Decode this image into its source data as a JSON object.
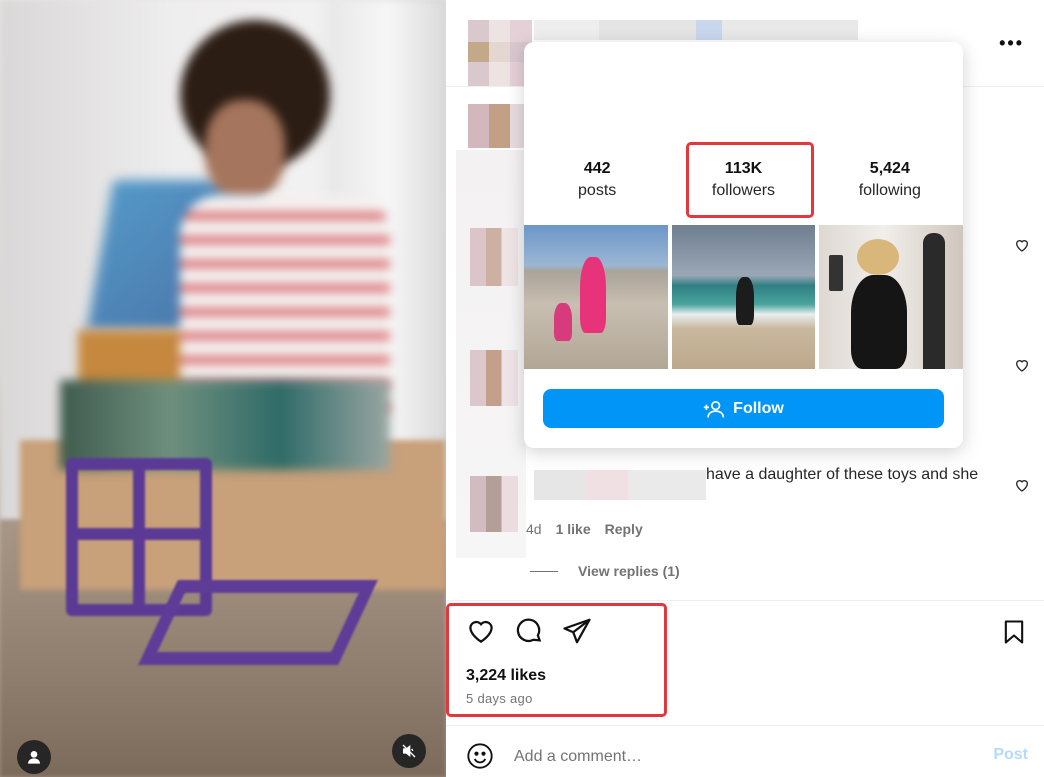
{
  "media": {
    "avatar_icon": "person-icon",
    "mute_icon": "speaker-muted-icon"
  },
  "post_header": {
    "more_label": "•••"
  },
  "hover_card": {
    "stats": [
      {
        "value": "442",
        "label": "posts"
      },
      {
        "value": "113K",
        "label": "followers"
      },
      {
        "value": "5,424",
        "label": "following"
      }
    ],
    "follow_label": "Follow",
    "follow_icon": "add-person-icon",
    "highlight_color": "#e0383e",
    "button_color": "#0095f6"
  },
  "comments": {
    "visible_fragment": "have a daughter of these toys and she",
    "time": "4d",
    "likes": "1 like",
    "reply_label": "Reply",
    "view_replies": "View replies (1)"
  },
  "actions": {
    "like_icon": "heart-icon",
    "comment_icon": "comment-bubble-icon",
    "share_icon": "paper-plane-icon",
    "save_icon": "bookmark-icon",
    "likes_count": "3,224 likes",
    "posted": "5 days ago"
  },
  "comment_box": {
    "placeholder": "Add a comment…",
    "post_label": "Post",
    "emoji_icon": "smiley-icon"
  }
}
